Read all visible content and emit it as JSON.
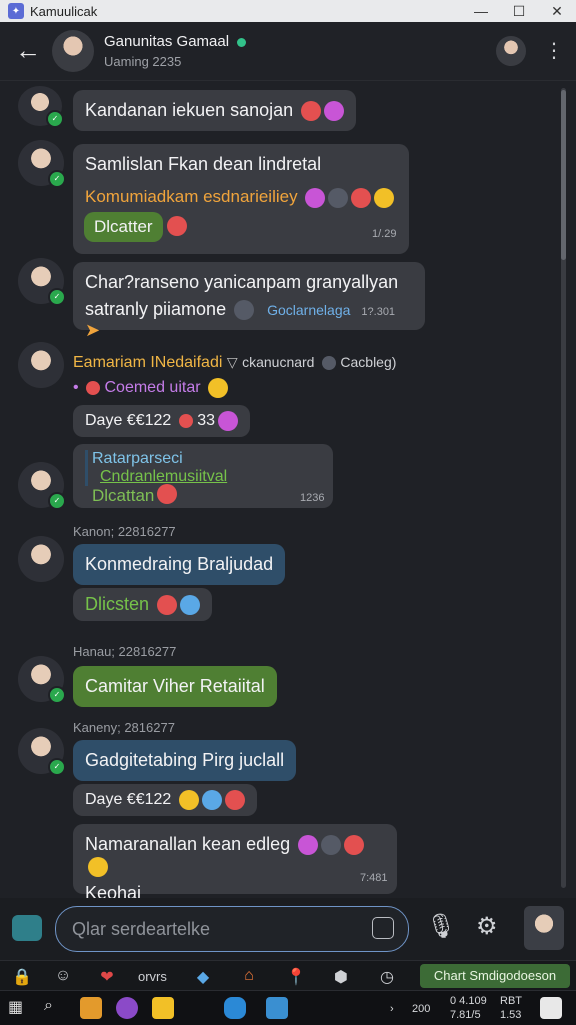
{
  "window": {
    "title": "Kamuulicak",
    "min": "—",
    "max": "☐",
    "close": "✕"
  },
  "header": {
    "name": "Ganunitas Gamaal",
    "status": "Uaming 2235"
  },
  "messages": [
    {
      "text": "Kandanan iekuen sanojan"
    },
    {
      "line1": "Samlislan Fkan dean lindretal",
      "line2": "Komumiadkam esdnarieiliey",
      "button": "Dlcatter",
      "time": "1/.29"
    },
    {
      "line1": "Char?ranseno yanicanpam granyallyan",
      "line2": "satranly piiamone",
      "link": "Goclarnelaga",
      "time": "1?.301"
    },
    {
      "name": "Eamariam INedaifadi",
      "extra": "ckanucnard",
      "extra2": "Cacbleg)",
      "line2": "Coemed uitar",
      "day": "Daye €€122",
      "count": "33",
      "quote": "Ratarparseci",
      "quote_link": "Cndranlemusiitval",
      "button": "Dlcattan",
      "time": "1236"
    },
    {
      "meta": "Kanon; 22816277",
      "text": "Konmedraing Braljudad",
      "button": "Dlicsten"
    },
    {
      "meta": "Hanau; 22816277",
      "text": "Camitar Viher Retaiital"
    },
    {
      "meta": "Kaneny; 2816277",
      "text": "Gadgitetabing Pirg juclall",
      "day": "Daye €€122"
    },
    {
      "line1": "Namaranallan kean edleg",
      "line2": "Keohai",
      "time": "7:481"
    }
  ],
  "composer": {
    "placeholder": "Qlar serdeartelke"
  },
  "toolbar": {
    "label": "orvrs",
    "pill": "Chart Smdigodoeson"
  },
  "taskbar": {
    "time1": "0 4.109",
    "time2": "7.81/5",
    "date1": "RBT",
    "date2": "1.53",
    "lang": "200"
  }
}
